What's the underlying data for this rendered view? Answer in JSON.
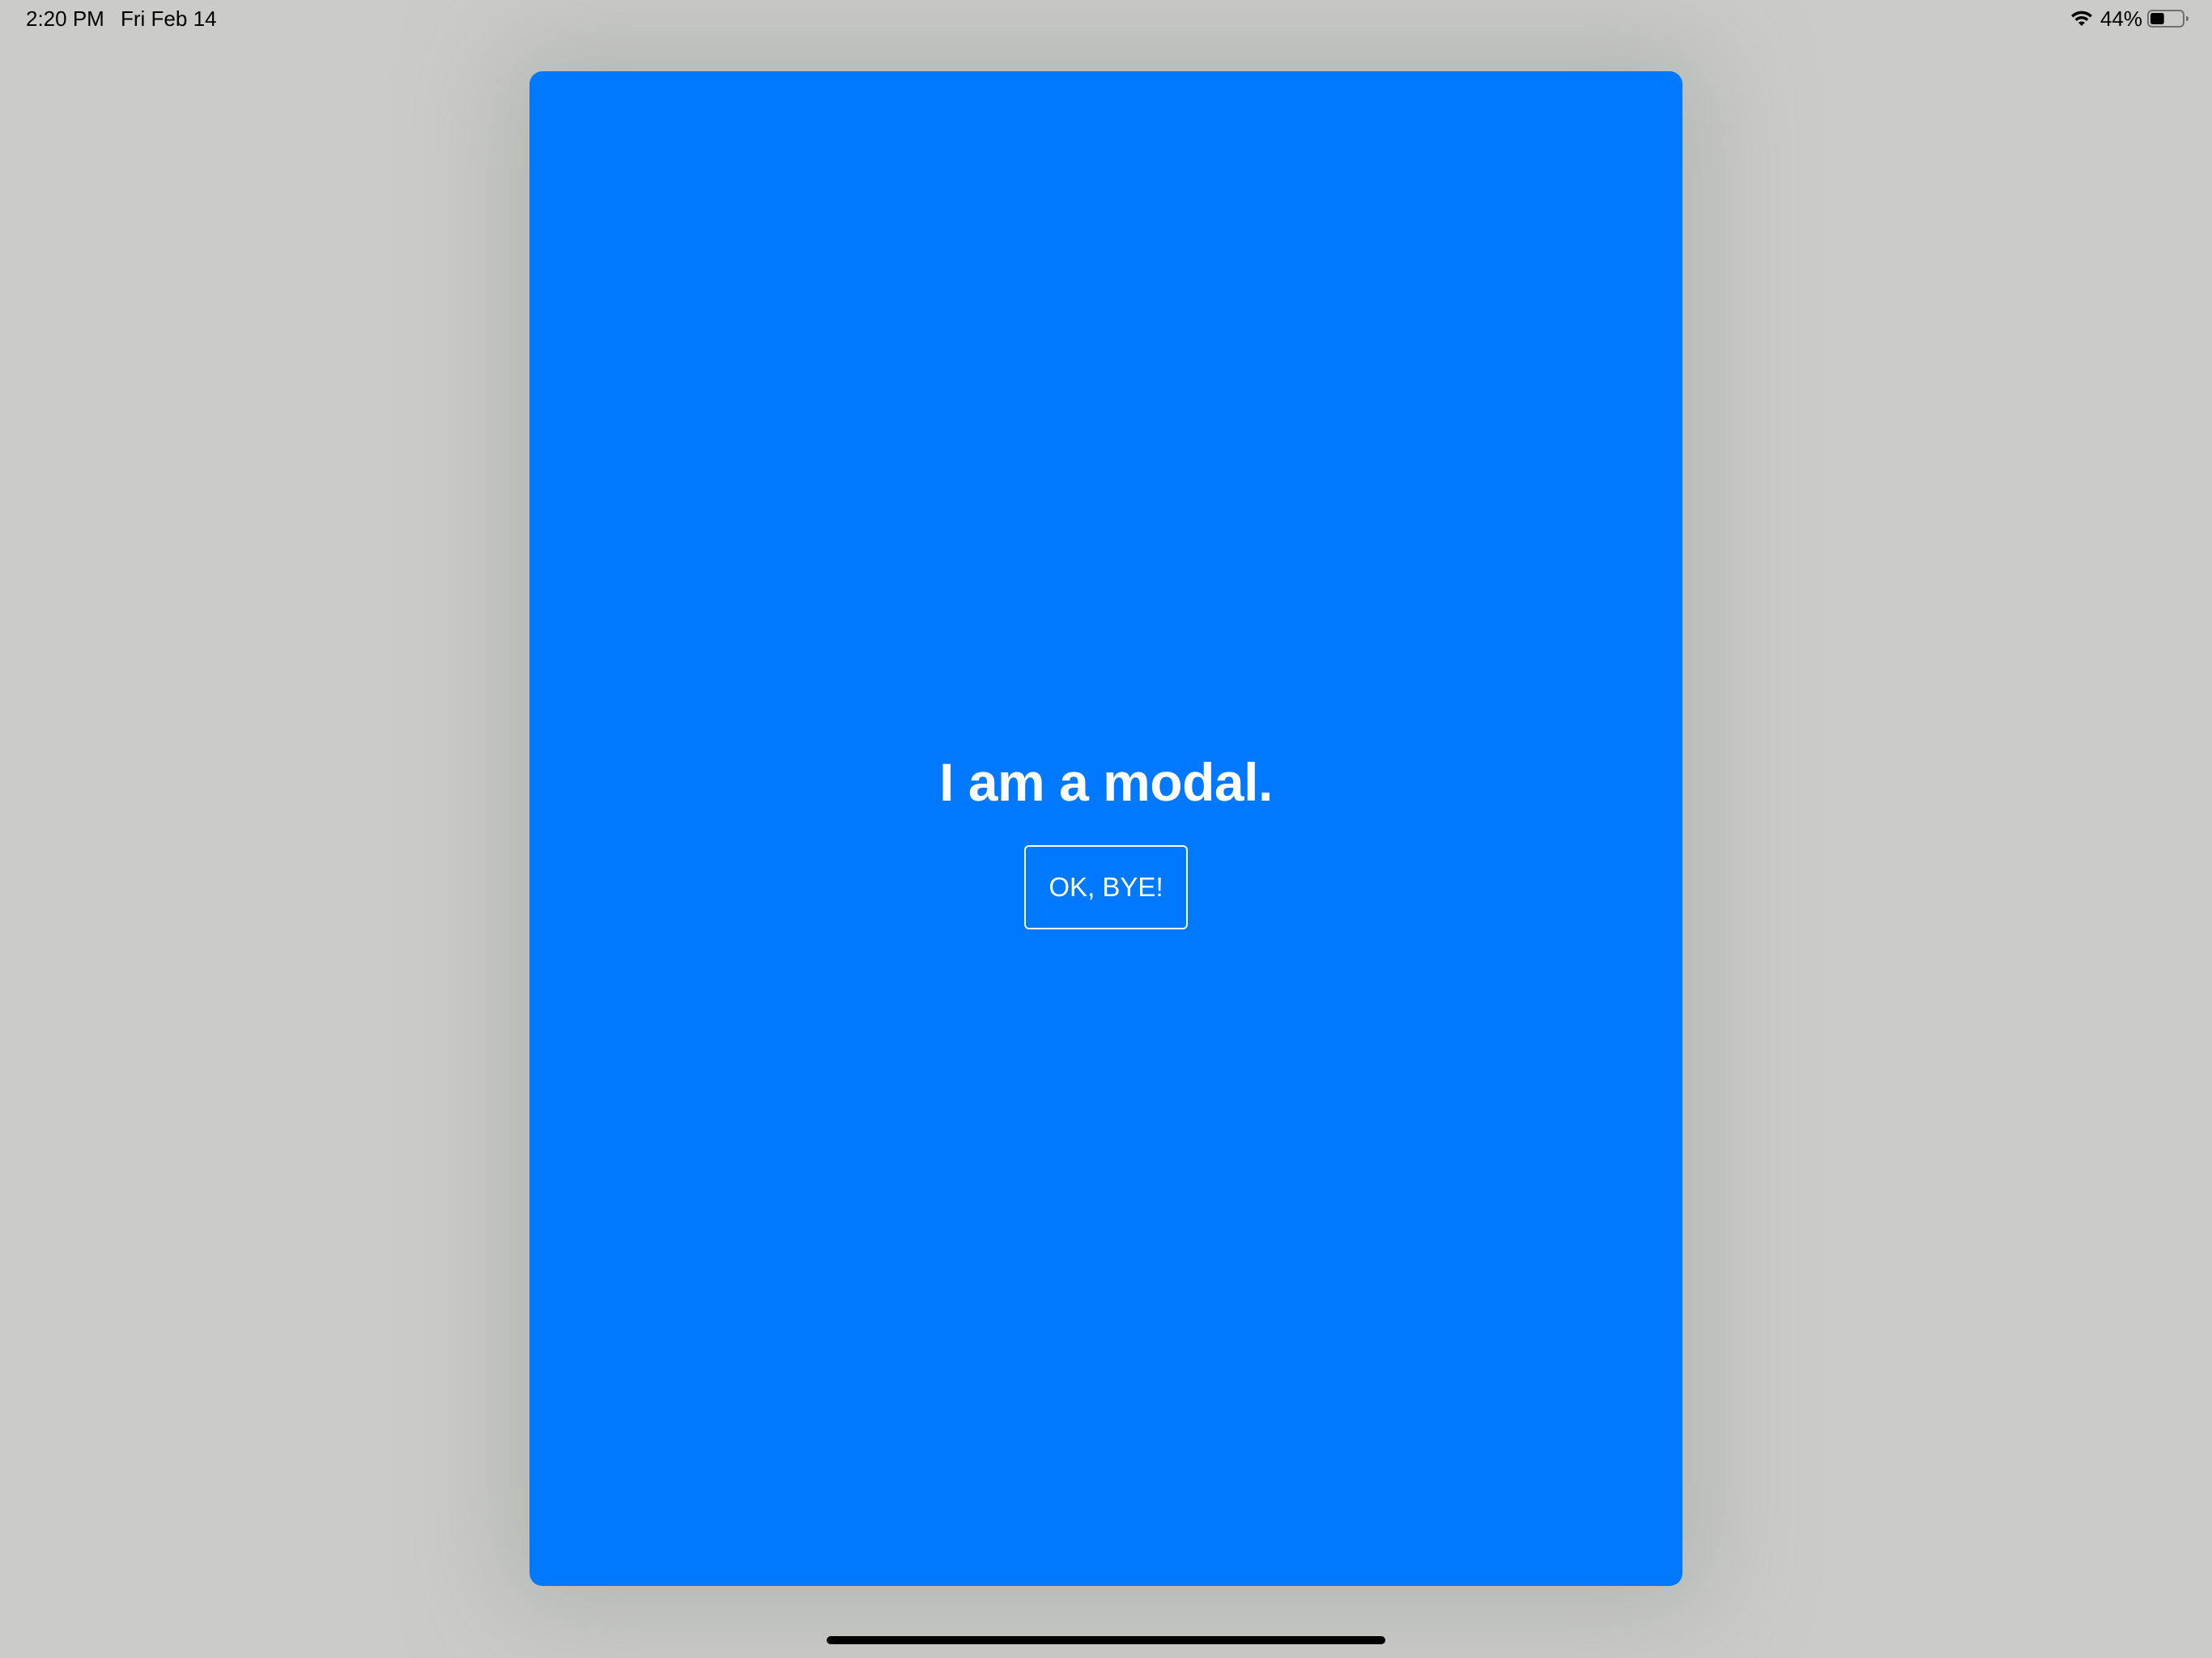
{
  "status_bar": {
    "time": "2:20 PM",
    "date": "Fri Feb 14",
    "battery_percent": "44%",
    "battery_level": 0.44,
    "icons": [
      "wifi-icon",
      "battery-icon"
    ]
  },
  "modal": {
    "background_color": "#0079fe",
    "title": "I am a modal.",
    "button_label": "OK, BYE!"
  },
  "colors": {
    "backdrop": "#cbcbca",
    "text_on_modal": "#ffffff",
    "home_indicator": "#000000"
  }
}
